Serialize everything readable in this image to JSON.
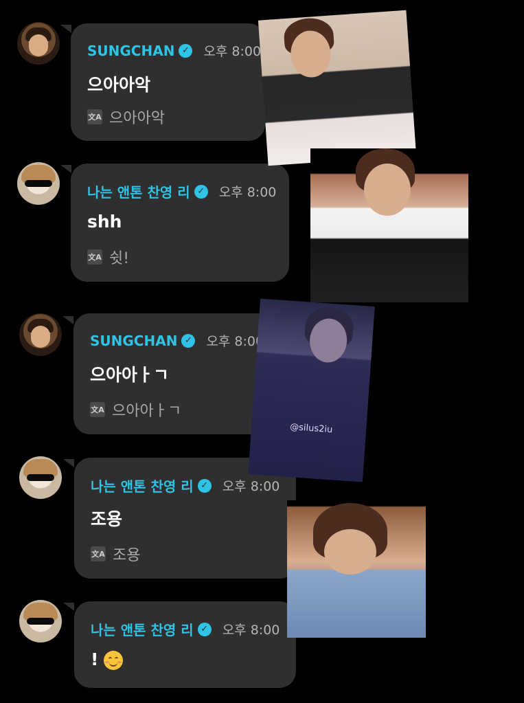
{
  "messages": [
    {
      "user": "SUNGCHAN",
      "time": "오후 8:00",
      "text": "으아아악",
      "translation": "으아아악"
    },
    {
      "user": "나는 앤톤 찬영 리",
      "time": "오후 8:00",
      "text": "shh",
      "translation": "쉿!"
    },
    {
      "user": "SUNGCHAN",
      "time": "오후 8:00",
      "text": "으아아ㅏㄱ",
      "translation": "으아아ㅏㄱ"
    },
    {
      "user": "나는 앤톤 찬영 리",
      "time": "오후 8:00",
      "text": "조용",
      "translation": "조용"
    },
    {
      "user": "나는 앤톤 찬영 리",
      "time": "오후 8:00",
      "text": "!",
      "emoji": "smiling-face-emoji"
    }
  ],
  "icons": {
    "verified": "verified-badge-icon",
    "translate": "translate-icon"
  },
  "photos": {
    "watermark": "@silus2iu"
  },
  "colors": {
    "background": "#000000",
    "bubble": "#2f2f2f",
    "name": "#2fc3e6",
    "time": "#b5b5b5",
    "translation": "#a8a8a8"
  }
}
